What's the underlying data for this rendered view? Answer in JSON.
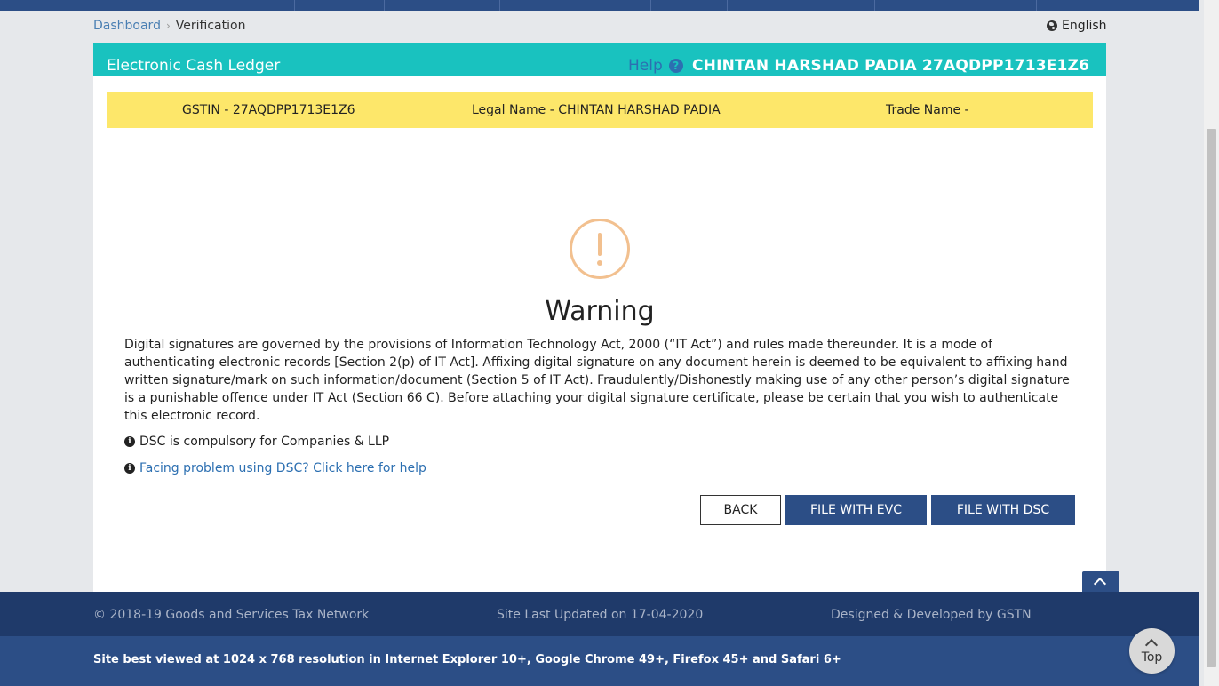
{
  "breadcrumb": {
    "home": "Dashboard",
    "separator": "›",
    "current": "Verification"
  },
  "language": {
    "label": "English",
    "icon": "globe-icon"
  },
  "panel": {
    "title": "Electronic Cash Ledger",
    "help_label": "Help",
    "help_icon": "?",
    "user_id": "CHINTAN HARSHAD PADIA 27AQDPP1713E1Z6"
  },
  "taxpayer": {
    "gstin": "GSTIN - 27AQDPP1713E1Z6",
    "legal_name": "Legal Name - CHINTAN HARSHAD PADIA",
    "trade_name": "Trade Name -"
  },
  "warning": {
    "title": "Warning",
    "body": "Digital signatures are governed by the provisions of Information Technology Act, 2000 (“IT Act”) and rules made thereunder. It is a mode of authenticating electronic records [Section 2(p) of IT Act]. Affixing digital signature on any document herein is deemed to be equivalent to affixing hand written signature/mark on such information/document (Section 5 of IT Act). Fraudulently/Dishonestly making use of any other person’s digital signature is a punishable offence under IT Act (Section 66 C). Before attaching your digital signature certificate, please be certain that you wish to authenticate this electronic record.",
    "note_dsc": "DSC is compulsory for Companies & LLP",
    "note_help": "Facing problem using DSC? Click here for help",
    "info_icon": "i"
  },
  "actions": {
    "back": "BACK",
    "file_evc": "FILE WITH EVC",
    "file_dsc": "FILE WITH DSC"
  },
  "footer": {
    "copyright": "© 2018-19 Goods and Services Tax Network",
    "last_updated": "Site Last Updated on 17-04-2020",
    "developer": "Designed & Developed by GSTN",
    "browser_note": "Site best viewed at 1024 x 768 resolution in Internet Explorer 10+, Google Chrome 49+, Firefox 45+ and Safari 6+"
  },
  "scroll_top": {
    "label": "Top"
  },
  "colors": {
    "header_teal": "#19c2bf",
    "info_yellow": "#fde76a",
    "navy": "#2c4e86",
    "footer_dark": "#1f3a6a",
    "warning_orange": "#f2c08f",
    "link_blue": "#2c6fb1"
  }
}
